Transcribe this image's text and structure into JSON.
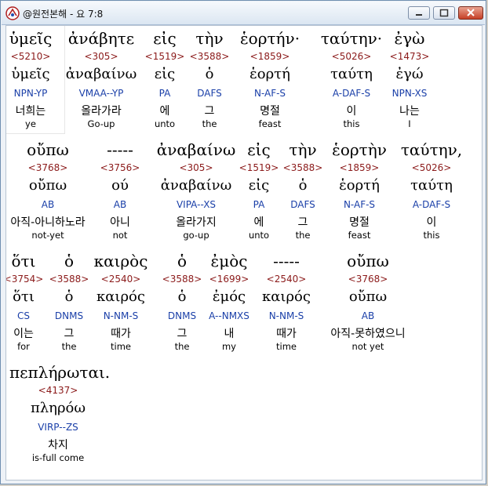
{
  "window": {
    "title": "@원전본해 - 요 7:8"
  },
  "rows": [
    [
      {
        "g": "ὑμεῖς",
        "num": "<5210>",
        "lem": "ὑμεῖς",
        "par": "NPN-YP",
        "ko": "너희는",
        "en": "ye"
      },
      {
        "g": "ἀνάβητε",
        "num": "<305>",
        "lem": "ἀναβαίνω",
        "par": "VMAA--YP",
        "ko": "올라가라",
        "en": "Go-up"
      },
      {
        "g": "εἰς",
        "num": "<1519>",
        "lem": "εἰς",
        "par": "PA",
        "ko": "에",
        "en": "unto"
      },
      {
        "g": "τὴν",
        "num": "<3588>",
        "lem": "ὁ",
        "par": "DAFS",
        "ko": "그",
        "en": "the"
      },
      {
        "g": "ἑορτήν·",
        "num": "<1859>",
        "lem": "ἑορτή",
        "par": "N-AF-S",
        "ko": "명절",
        "en": "feast"
      },
      {
        "g": "ταύτην·",
        "num": "<5026>",
        "lem": "ταύτη",
        "par": "A-DAF-S",
        "ko": "이",
        "en": "this"
      },
      {
        "g": "ἐγὼ",
        "num": "<1473>",
        "lem": "ἐγώ",
        "par": "NPN-XS",
        "ko": "나는",
        "en": "I"
      }
    ],
    [
      {
        "g": "οὔπω",
        "num": "<3768>",
        "lem": "οὔπω",
        "par": "AB",
        "ko": "아직-아니하노라",
        "en": "not-yet"
      },
      {
        "g": "-----",
        "num": "<3756>",
        "lem": "ού",
        "par": "AB",
        "ko": "아니",
        "en": "not"
      },
      {
        "g": "ἀναβαίνω",
        "num": "<305>",
        "lem": "ἀναβαίνω",
        "par": "VIPA--XS",
        "ko": "올라가지",
        "en": "go-up"
      },
      {
        "g": "εἰς",
        "num": "<1519>",
        "lem": "εἰς",
        "par": "PA",
        "ko": "에",
        "en": "unto"
      },
      {
        "g": "τὴν",
        "num": "<3588>",
        "lem": "ὁ",
        "par": "DAFS",
        "ko": "그",
        "en": "the"
      },
      {
        "g": "ἑορτὴν",
        "num": "<1859>",
        "lem": "ἑορτή",
        "par": "N-AF-S",
        "ko": "명절",
        "en": "feast"
      },
      {
        "g": "ταύτην,",
        "num": "<5026>",
        "lem": "ταύτη",
        "par": "A-DAF-S",
        "ko": "이",
        "en": "this"
      }
    ],
    [
      {
        "g": "ὅτι",
        "num": "<3754>",
        "lem": "ὅτι",
        "par": "CS",
        "ko": "이는",
        "en": "for"
      },
      {
        "g": "ὁ",
        "num": "<3588>",
        "lem": "ὁ",
        "par": "DNMS",
        "ko": "그",
        "en": "the"
      },
      {
        "g": "καιρὸς",
        "num": "<2540>",
        "lem": "καιρός",
        "par": "N-NM-S",
        "ko": "때가",
        "en": "time"
      },
      {
        "g": "ὁ",
        "num": "<3588>",
        "lem": "ὁ",
        "par": "DNMS",
        "ko": "그",
        "en": "the"
      },
      {
        "g": "ἐμὸς",
        "num": "<1699>",
        "lem": "ἐμός",
        "par": "A--NMXS",
        "ko": "내",
        "en": "my"
      },
      {
        "g": "-----",
        "num": "<2540>",
        "lem": "καιρός",
        "par": "N-NM-S",
        "ko": "때가",
        "en": "time"
      },
      {
        "g": "οὔπω",
        "num": "<3768>",
        "lem": "οὔπω",
        "par": "AB",
        "ko": "아직-못하였으니",
        "en": "not yet"
      }
    ],
    [
      {
        "g": "πεπλήρωται.",
        "num": "<4137>",
        "lem": "πληρόω",
        "par": "VIRP--ZS",
        "ko": "차지",
        "en": "is-full come"
      }
    ]
  ]
}
